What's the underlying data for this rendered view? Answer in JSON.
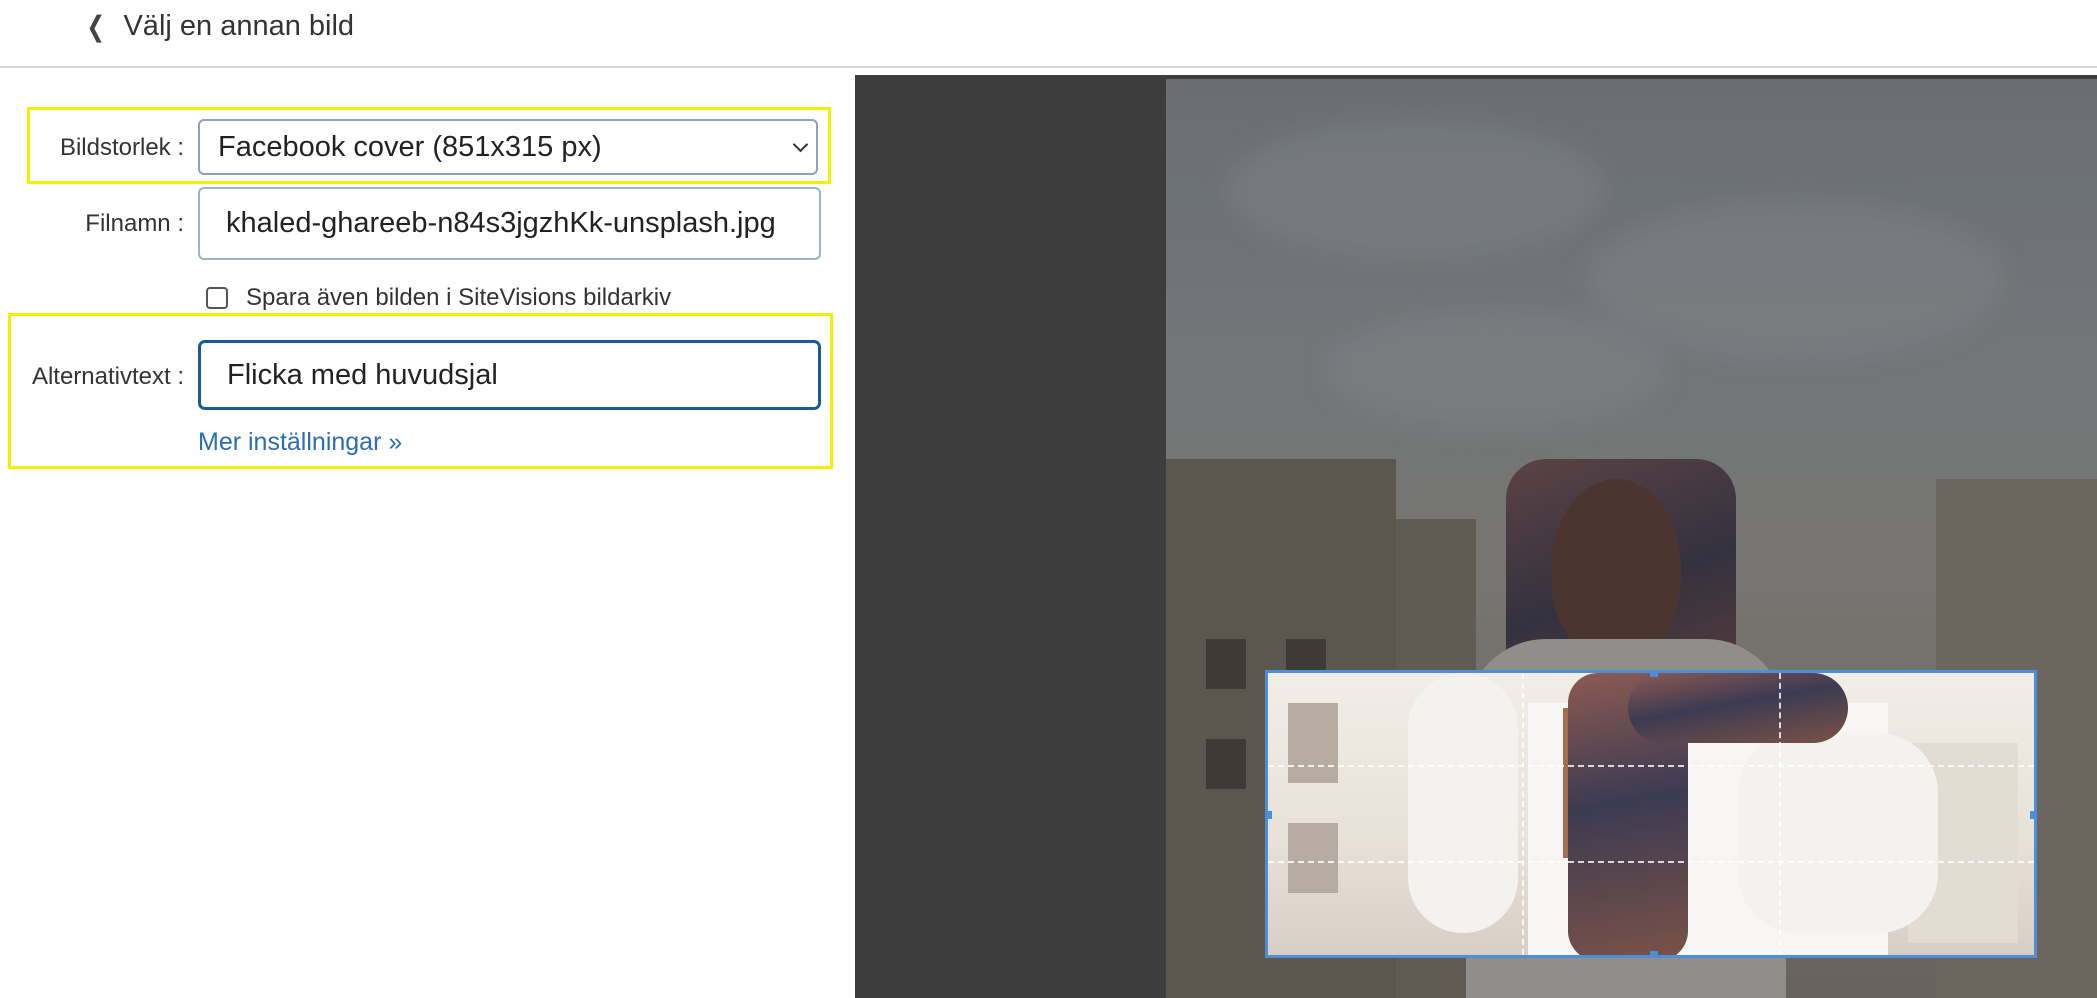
{
  "header": {
    "back_label": "Välj en annan bild"
  },
  "form": {
    "size_label": "Bildstorlek :",
    "size_value": "Facebook cover (851x315 px)",
    "filename_label": "Filnamn :",
    "filename_value": "khaled-ghareeb-n84s3jgzhKk-unsplash.jpg",
    "save_archive_label": "Spara även bilden i SiteVisions bildarkiv",
    "alt_label": "Alternativtext :",
    "alt_value": "Flicka med huvudsjal",
    "more_settings": "Mer inställningar »"
  },
  "icons": {
    "back": "chevron-left-icon",
    "dropdown": "chevron-down-icon"
  },
  "colors": {
    "highlight": "#f5f000",
    "link": "#2a6db5",
    "crop_border": "#4d8ed8",
    "preview_bg": "#3d3d3d"
  }
}
